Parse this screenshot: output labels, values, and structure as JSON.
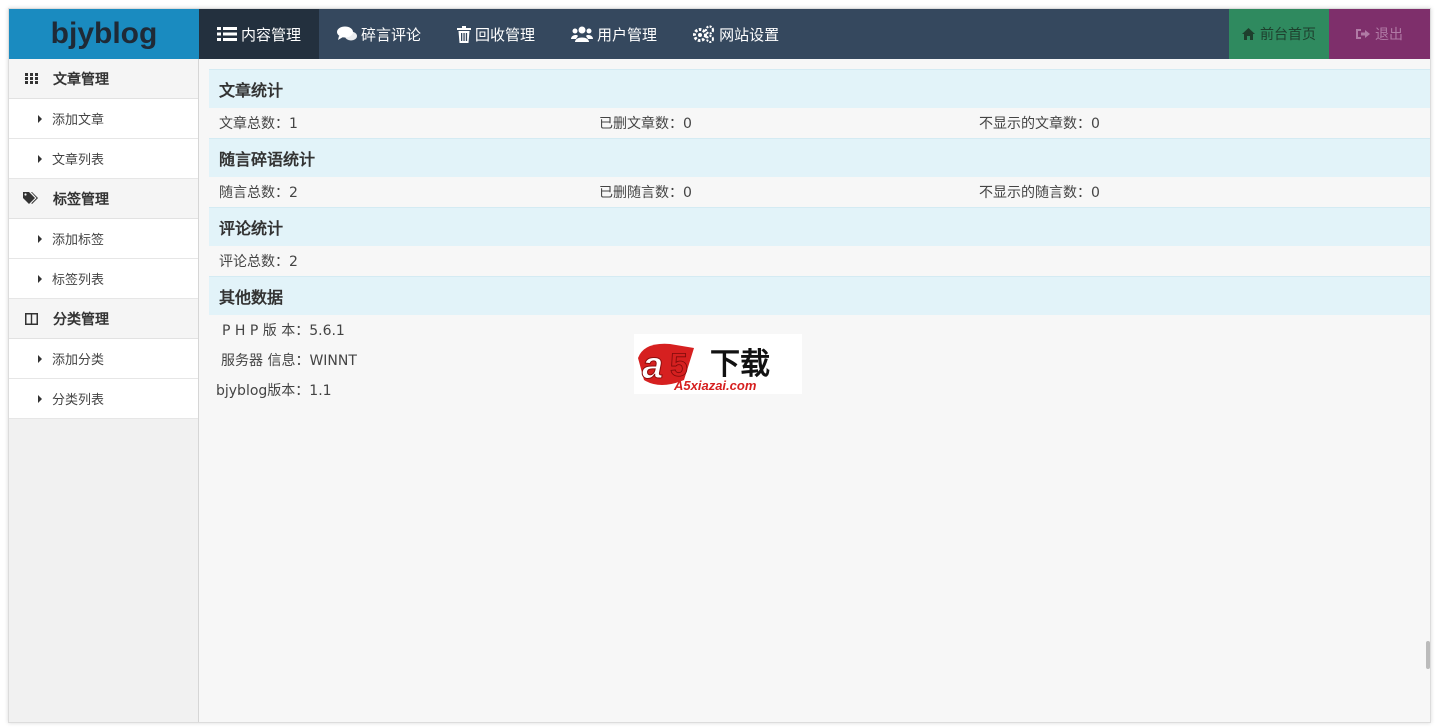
{
  "brand": "bjyblog",
  "nav": {
    "items": [
      {
        "label": "内容管理",
        "icon": "list-icon"
      },
      {
        "label": "碎言评论",
        "icon": "comments-icon"
      },
      {
        "label": "回收管理",
        "icon": "trash-icon"
      },
      {
        "label": "用户管理",
        "icon": "users-icon"
      },
      {
        "label": "网站设置",
        "icon": "gears-icon"
      }
    ],
    "home_label": "前台首页",
    "logout_label": "退出"
  },
  "sidebar": {
    "groups": [
      {
        "label": "文章管理",
        "icon": "grid-icon",
        "items": [
          "添加文章",
          "文章列表"
        ]
      },
      {
        "label": "标签管理",
        "icon": "tags-icon",
        "items": [
          "添加标签",
          "标签列表"
        ]
      },
      {
        "label": "分类管理",
        "icon": "columns-icon",
        "items": [
          "添加分类",
          "分类列表"
        ]
      }
    ]
  },
  "stats": {
    "article": {
      "title": "文章统计",
      "total": "文章总数：1",
      "deleted": "已删文章数：0",
      "hidden": "不显示的文章数：0"
    },
    "chat": {
      "title": "随言碎语统计",
      "total": "随言总数：2",
      "deleted": "已删随言数：0",
      "hidden": "不显示的随言数：0"
    },
    "comment": {
      "title": "评论统计",
      "total": "评论总数：2"
    },
    "other": {
      "title": "其他数据",
      "php": "P H P 版 本：5.6.1",
      "server": "服务器 信息：WINNT",
      "version": "bjyblog版本：1.1"
    }
  },
  "watermark": {
    "text_cn": "下载",
    "text_url": "A5xiazai.com"
  },
  "colors": {
    "brand_bg": "#1a8bc0",
    "nav_bg": "#35485e",
    "nav_active": "#23303e",
    "home_bg": "#2f8a5f",
    "logout_bg": "#7e2f6b",
    "section_head": "#e2f3f9"
  }
}
